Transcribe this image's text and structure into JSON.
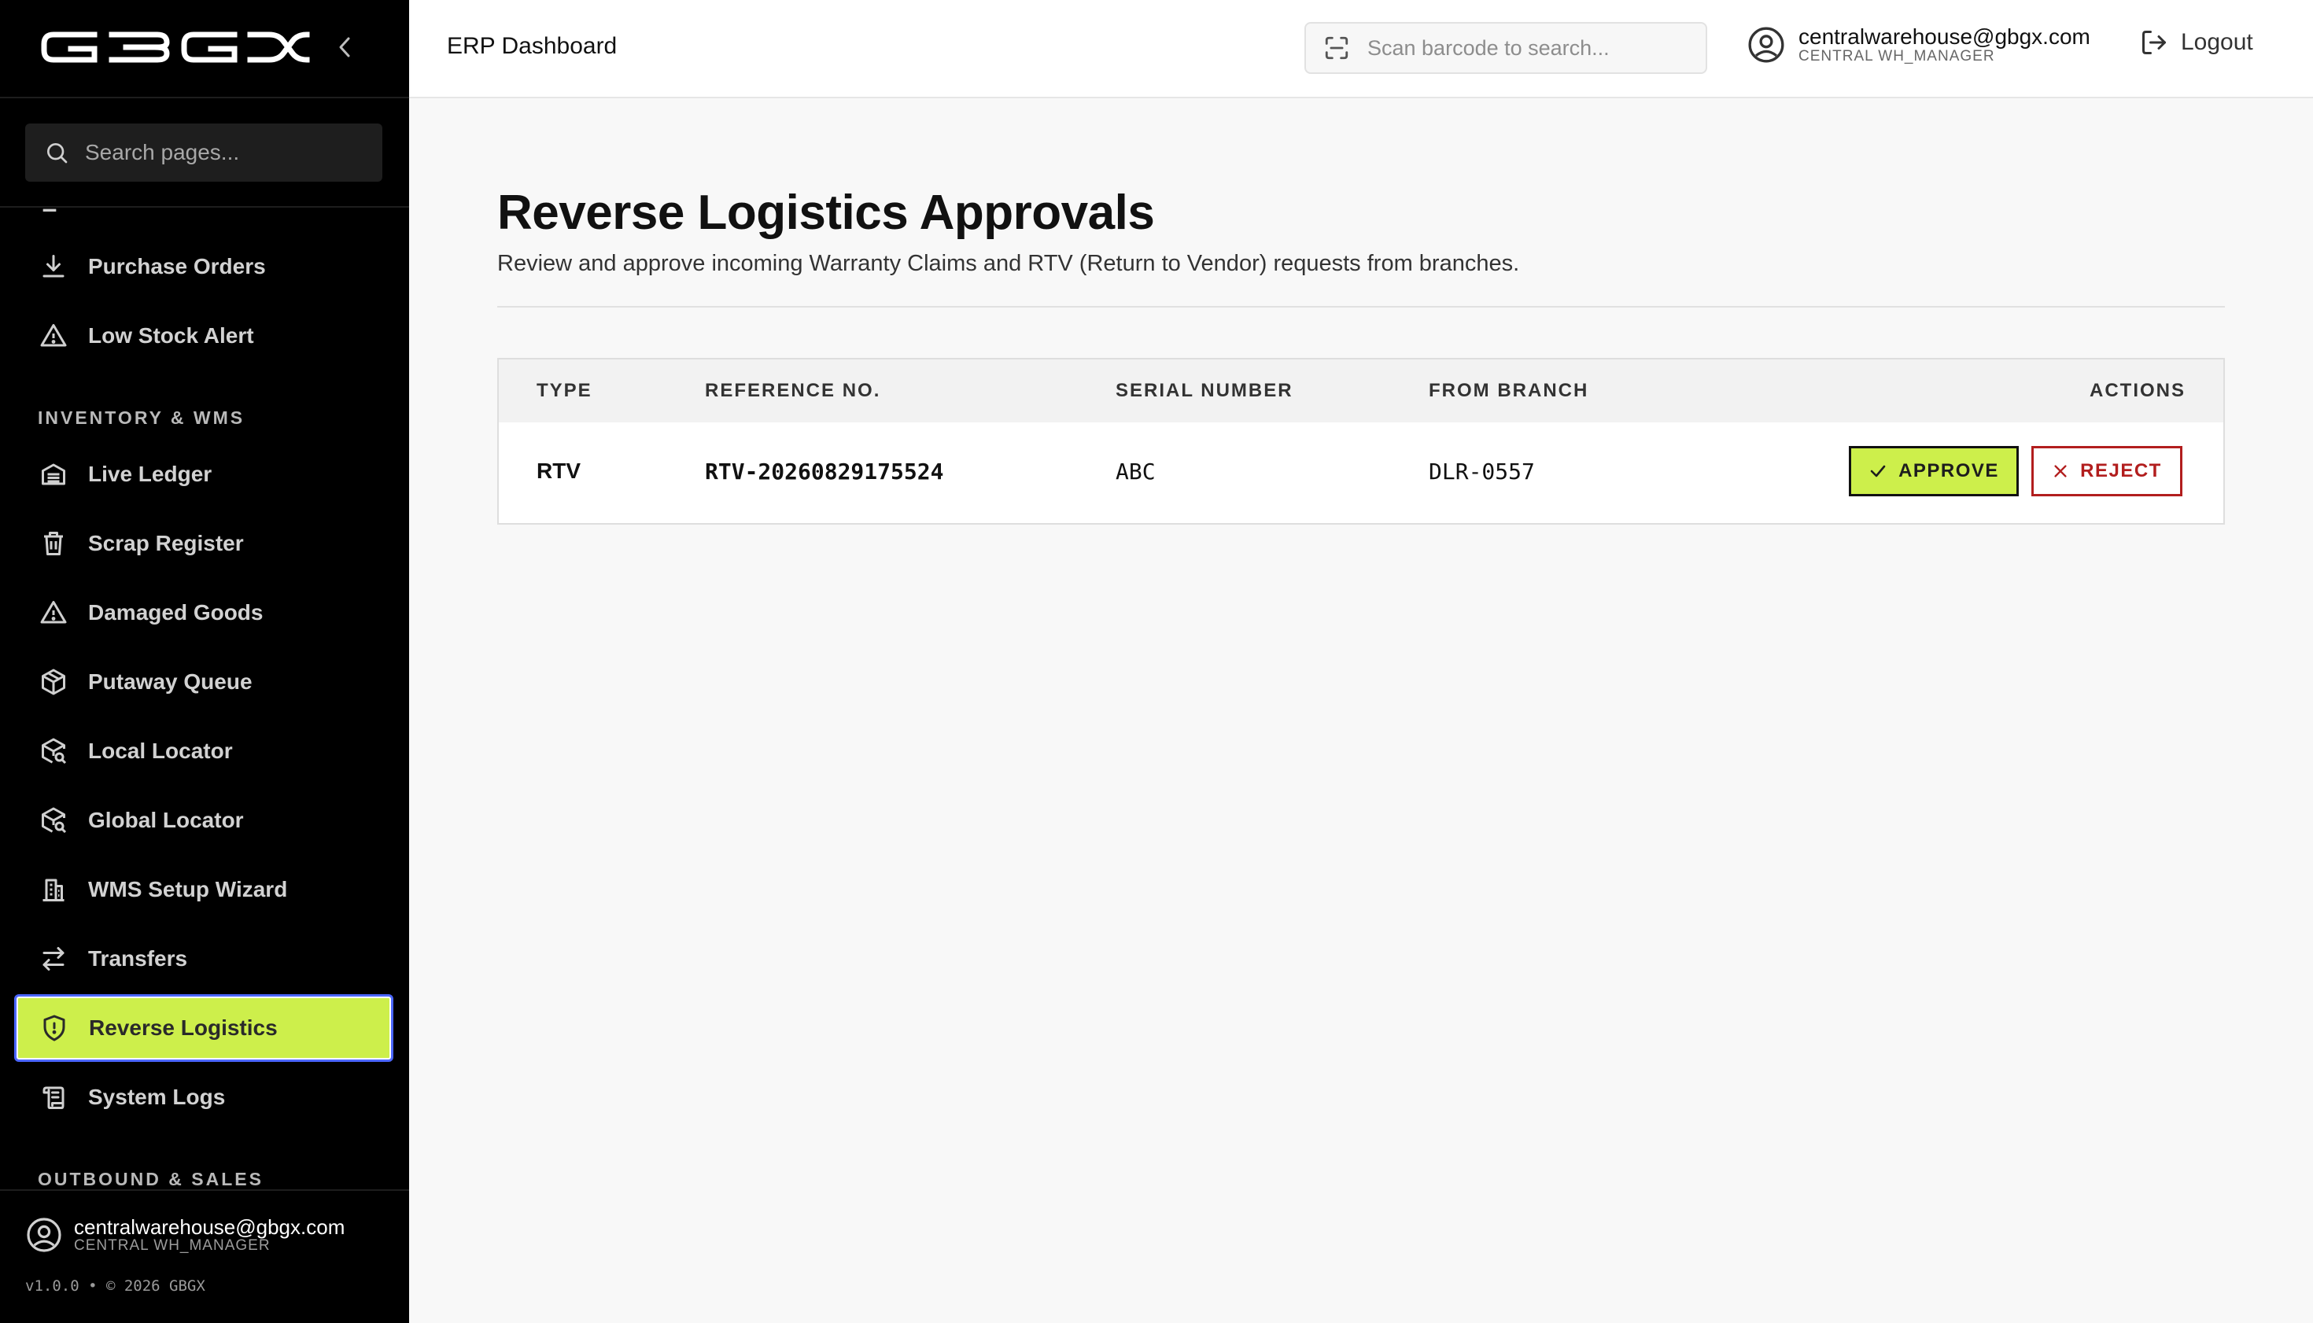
{
  "sidebar": {
    "brand": "GBGX",
    "search_placeholder": "Search pages...",
    "sections": {
      "inventory": "INVENTORY & WMS",
      "outbound": "OUTBOUND & SALES"
    },
    "items": [
      {
        "label": "Purchase Orders",
        "icon": "download-icon"
      },
      {
        "label": "Low Stock Alert",
        "icon": "warning-icon"
      },
      {
        "label": "Live Ledger",
        "icon": "warehouse-icon"
      },
      {
        "label": "Scrap Register",
        "icon": "trash-icon"
      },
      {
        "label": "Damaged Goods",
        "icon": "warning-icon"
      },
      {
        "label": "Putaway Queue",
        "icon": "package-icon"
      },
      {
        "label": "Local Locator",
        "icon": "package-search-icon"
      },
      {
        "label": "Global Locator",
        "icon": "package-search-icon"
      },
      {
        "label": "WMS Setup Wizard",
        "icon": "building-icon"
      },
      {
        "label": "Transfers",
        "icon": "arrows-swap-icon"
      },
      {
        "label": "Reverse Logistics",
        "icon": "shield-alert-icon",
        "active": true
      },
      {
        "label": "System Logs",
        "icon": "scroll-icon"
      }
    ],
    "footer": {
      "email": "centralwarehouse@gbgx.com",
      "role": "CENTRAL WH_MANAGER",
      "version": "v1.0.0 • © 2026 GBGX"
    }
  },
  "topbar": {
    "title": "ERP Dashboard",
    "barcode_placeholder": "Scan barcode to search...",
    "user_email": "centralwarehouse@gbgx.com",
    "user_role": "CENTRAL WH_MANAGER",
    "logout_label": "Logout"
  },
  "main": {
    "title": "Reverse Logistics Approvals",
    "subtitle": "Review and approve incoming Warranty Claims and RTV (Return to Vendor) requests from branches.",
    "table": {
      "headers": {
        "type": "TYPE",
        "reference": "REFERENCE NO.",
        "serial": "SERIAL NUMBER",
        "branch": "FROM BRANCH",
        "actions": "ACTIONS"
      },
      "rows": [
        {
          "type": "RTV",
          "reference": "RTV-20260829175524",
          "serial": "ABC",
          "branch": "DLR-0557",
          "approve_label": "APPROVE",
          "reject_label": "REJECT"
        }
      ]
    }
  },
  "colors": {
    "accent": "#cdef4b",
    "sidebar_bg": "#000000",
    "reject": "#b21e1e",
    "active_outline": "#4b66ff"
  }
}
